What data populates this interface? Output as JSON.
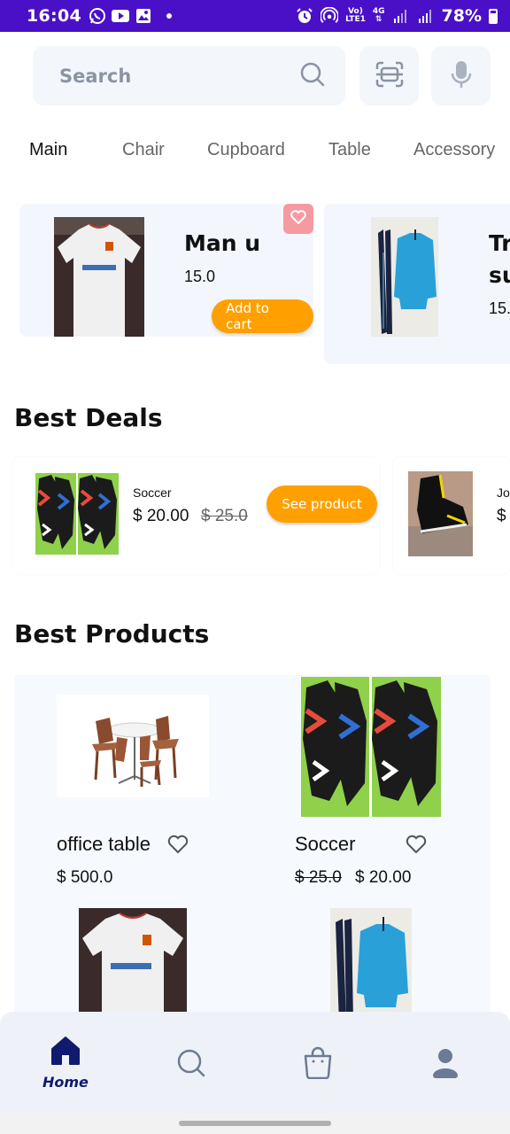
{
  "status_bar": {
    "time": "16:04",
    "network_top": "Vo)",
    "network_bottom": "LTE1",
    "network_type": "4G",
    "battery": "78%"
  },
  "search": {
    "placeholder": "Search"
  },
  "categories": [
    "Main",
    "Chair",
    "Cupboard",
    "Table",
    "Accessory"
  ],
  "featured": [
    {
      "name": "Man u",
      "price": "15.0",
      "button": "Add to cart"
    },
    {
      "name": "Tr",
      "name2": "su",
      "price": "15."
    }
  ],
  "best_deals": {
    "title": "Best Deals",
    "items": [
      {
        "label": "Soccer",
        "price": "$ 20.00",
        "old_price": "$ 25.0",
        "button": "See product"
      },
      {
        "label": "Jo",
        "price": "$"
      }
    ]
  },
  "best_products": {
    "title": "Best Products",
    "items": [
      {
        "name": "office table",
        "price": "$ 500.0"
      },
      {
        "name": "Soccer",
        "old_price": "$ 25.0",
        "price": "$ 20.00"
      }
    ]
  },
  "bottom_nav": {
    "home_label": "Home"
  },
  "colors": {
    "accent": "#ffa000",
    "status_bar": "#4a10c8",
    "nav_active": "#101a6e",
    "favorite": "#f59aa0"
  }
}
